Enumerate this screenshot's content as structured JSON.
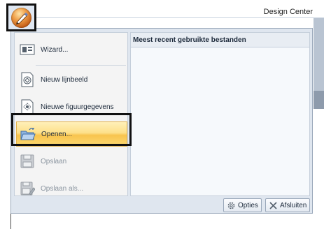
{
  "app": {
    "title": "Design Center"
  },
  "menu": {
    "items": [
      {
        "label": "Wizard...",
        "icon": "wizard-icon",
        "enabled": true
      },
      {
        "label": "Nieuw lijnbeeld",
        "icon": "new-line-image-icon",
        "enabled": true
      },
      {
        "label": "Nieuwe figuurgegevens",
        "icon": "new-figure-data-icon",
        "enabled": true
      },
      {
        "label": "Openen...",
        "icon": "open-folder-icon",
        "enabled": true,
        "active": true
      },
      {
        "label": "Opslaan",
        "icon": "save-icon",
        "enabled": false
      },
      {
        "label": "Opslaan als...",
        "icon": "save-as-icon",
        "enabled": false
      }
    ],
    "recent_header": "Meest recent gebruikte bestanden",
    "footer": {
      "options_label": "Opties",
      "exit_label": "Afsluiten"
    }
  },
  "colors": {
    "active_item": "#fde08a",
    "highlight_border": "#111111",
    "menu_bg": "#dfe6ef"
  }
}
